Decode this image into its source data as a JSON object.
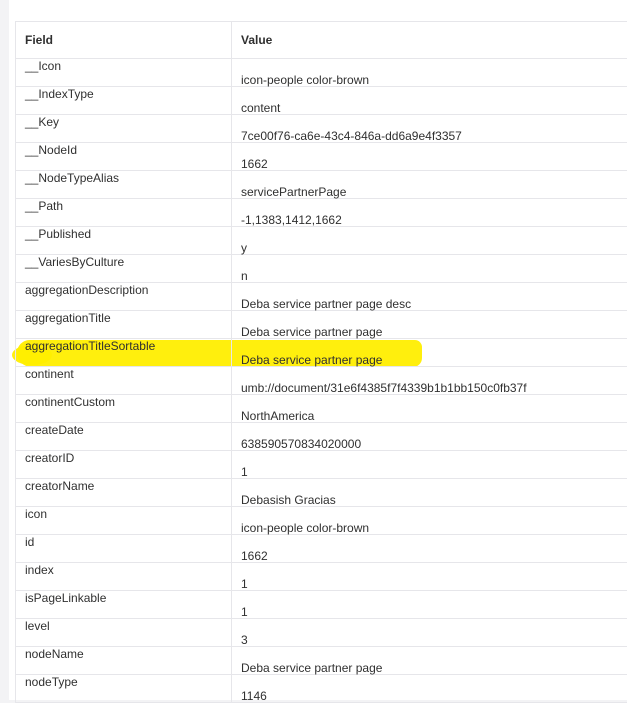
{
  "table": {
    "headers": {
      "field": "Field",
      "value": "Value"
    },
    "rows": [
      {
        "field": "__Icon",
        "value": "icon-people color-brown"
      },
      {
        "field": "__IndexType",
        "value": "content"
      },
      {
        "field": "__Key",
        "value": "7ce00f76-ca6e-43c4-846a-dd6a9e4f3357"
      },
      {
        "field": "__NodeId",
        "value": "1662"
      },
      {
        "field": "__NodeTypeAlias",
        "value": "servicePartnerPage"
      },
      {
        "field": "__Path",
        "value": "-1,1383,1412,1662"
      },
      {
        "field": "__Published",
        "value": "y"
      },
      {
        "field": "__VariesByCulture",
        "value": "n"
      },
      {
        "field": "aggregationDescription",
        "value": "Deba service partner page desc"
      },
      {
        "field": "aggregationTitle",
        "value": "Deba service partner page"
      },
      {
        "field": "aggregationTitleSortable",
        "value": "Deba service partner page",
        "highlighted": true
      },
      {
        "field": "continent",
        "value": "umb://document/31e6f4385f7f4339b1b1bb150c0fb37f"
      },
      {
        "field": "continentCustom",
        "value": "NorthAmerica"
      },
      {
        "field": "createDate",
        "value": "638590570834020000"
      },
      {
        "field": "creatorID",
        "value": "1"
      },
      {
        "field": "creatorName",
        "value": "Debasish Gracias"
      },
      {
        "field": "icon",
        "value": "icon-people color-brown"
      },
      {
        "field": "id",
        "value": "1662"
      },
      {
        "field": "index",
        "value": "1"
      },
      {
        "field": "isPageLinkable",
        "value": "1"
      },
      {
        "field": "level",
        "value": "3"
      },
      {
        "field": "nodeName",
        "value": "Deba service partner page"
      },
      {
        "field": "nodeType",
        "value": "1146"
      }
    ]
  },
  "colors": {
    "highlight": "#ffee00",
    "border": "#e6e6ea",
    "text": "#303030"
  }
}
